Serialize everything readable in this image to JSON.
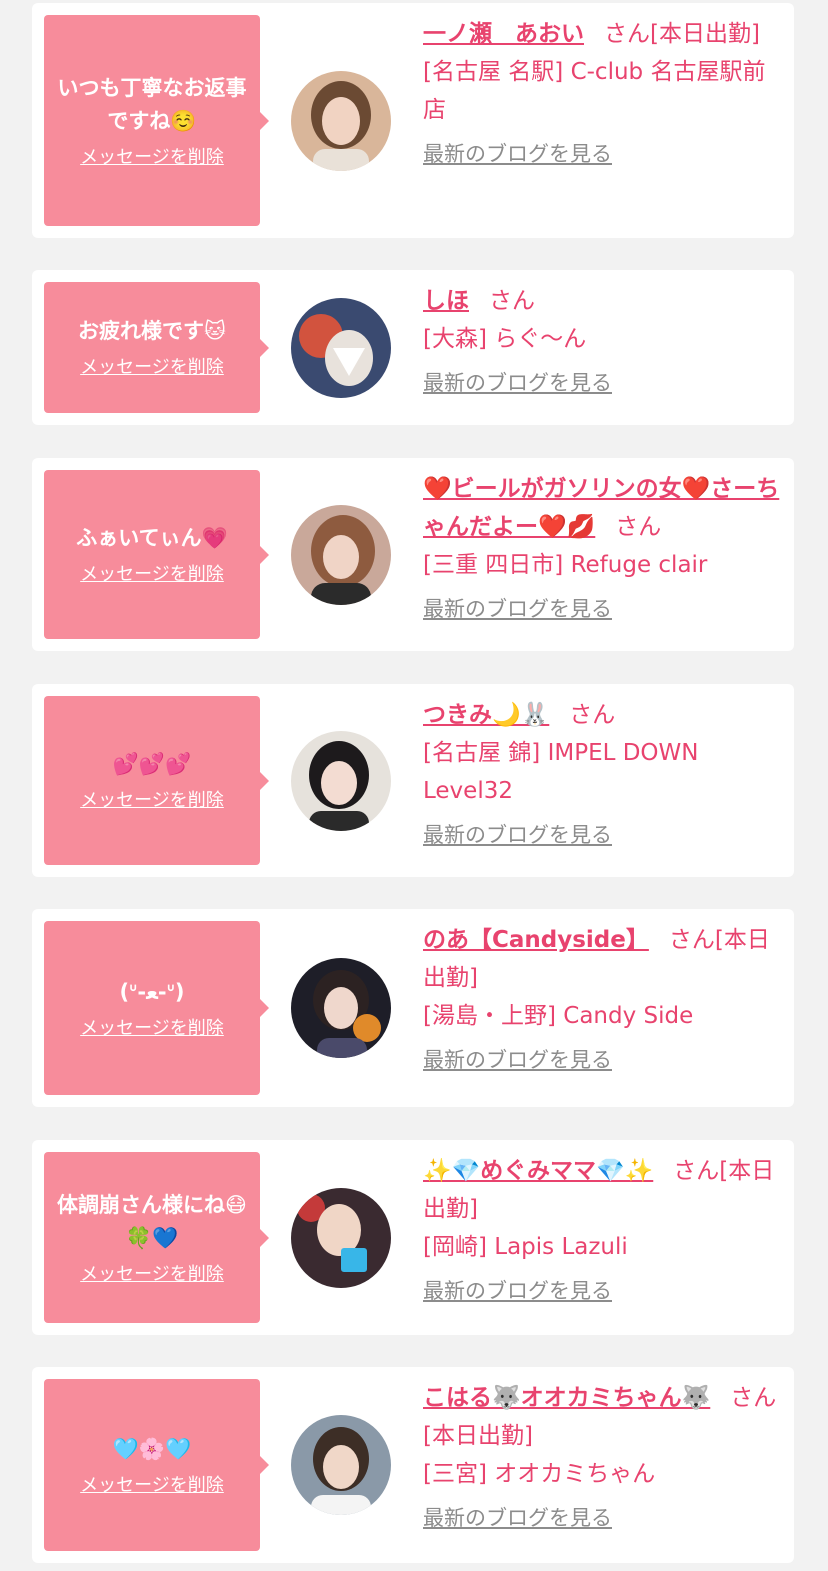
{
  "delete_label": "メッセージを削除",
  "blog_label": "最新のブログを見る",
  "colors": {
    "accent": "#e8436e",
    "bubble": "#f78c9b",
    "background": "#f2f2f2",
    "link_gray": "#8c8c8c"
  },
  "cards": [
    {
      "message": "いつも丁寧なお返事ですね☺️",
      "name": "一ノ瀬　あおい",
      "suffix": "さん[本日出勤]",
      "shop": "[名古屋 名駅] C-club 名古屋駅前店"
    },
    {
      "message": "お疲れ様です🐱",
      "name": "しほ",
      "suffix": "さん",
      "shop": "[大森] らぐ〜ん"
    },
    {
      "message": "ふぁいてぃん💗",
      "name": "❤️ビールがガソリンの女❤️さーちゃんだよー❤️💋",
      "suffix": "さん",
      "shop": "[三重 四日市] Refuge clair"
    },
    {
      "message": "💕💕💕",
      "name": "つきみ🌙🐰",
      "suffix": "さん",
      "shop": "[名古屋 錦] IMPEL DOWN Level32"
    },
    {
      "message": "(ᐡ-ﻌ-ᐡ)",
      "name": "のあ【Candyside】",
      "suffix": "さん[本日出勤]",
      "shop": "[湯島・上野] Candy Side"
    },
    {
      "message": "体調崩さん様にね😷🍀💙",
      "name": "✨💎めぐみママ💎✨",
      "suffix": "さん[本日出勤]",
      "shop": "[岡崎] Lapis Lazuli"
    },
    {
      "message": "🩵🌸🩵",
      "name": "こはる🐺オオカミちゃん🐺",
      "suffix": "さん[本日出勤]",
      "shop": "[三宮] オオカミちゃん"
    }
  ]
}
